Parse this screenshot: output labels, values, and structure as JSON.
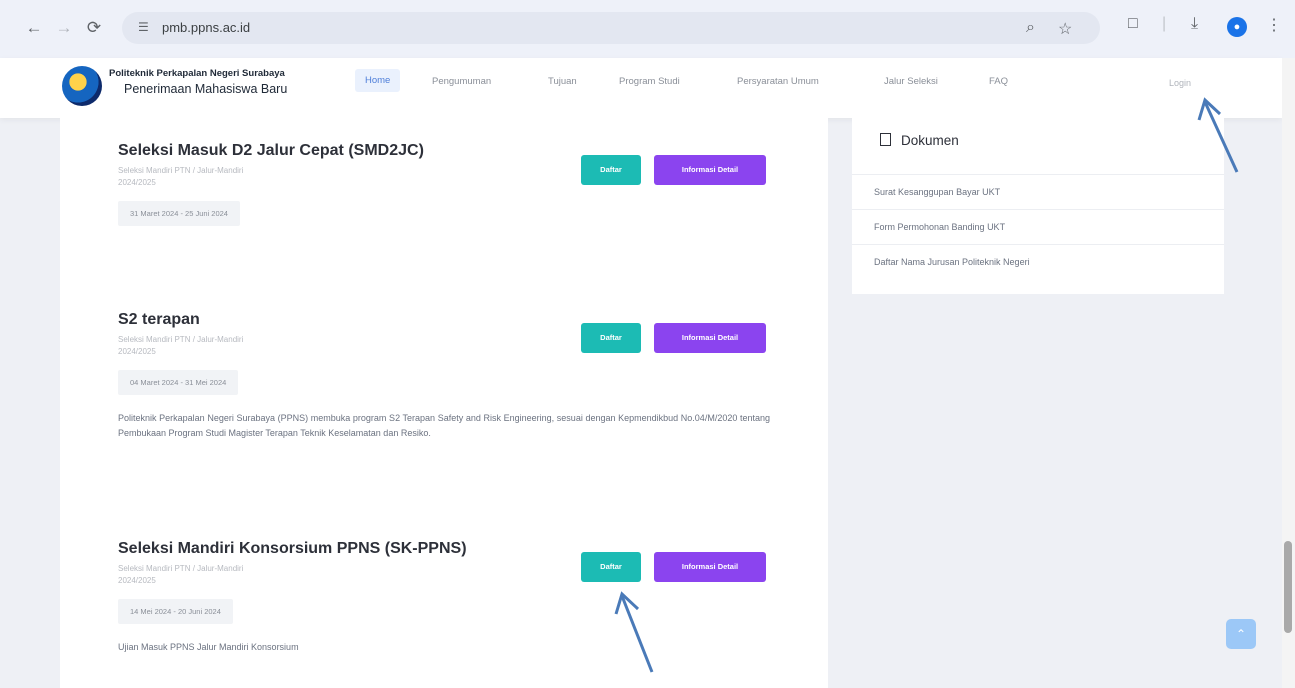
{
  "browser": {
    "url": "pmb.ppns.ac.id"
  },
  "header": {
    "brand_line1": "Politeknik Perkapalan Negeri Surabaya",
    "brand_line2": "Penerimaan Mahasiswa Baru",
    "nav": [
      "Home",
      "Pengumuman",
      "Tujuan",
      "Program Studi",
      "Persyaratan Umum",
      "Jalur Seleksi",
      "FAQ"
    ],
    "login": "Login"
  },
  "programs": [
    {
      "title": "Seleksi Masuk D2 Jalur Cepat (SMD2JC)",
      "category": "Seleksi Mandiri PTN / Jalur-Mandiri",
      "year": "2024/2025",
      "period": "31 Maret 2024 - 25 Juni 2024",
      "description": ""
    },
    {
      "title": "S2 terapan",
      "category": "Seleksi Mandiri PTN / Jalur-Mandiri",
      "year": "2024/2025",
      "period": "04 Maret 2024 - 31 Mei 2024",
      "description": "Politeknik Perkapalan Negeri Surabaya (PPNS) membuka program S2 Terapan Safety and Risk Engineering, sesuai dengan Kepmendikbud No.04/M/2020 tentang Pembukaan Program Studi Magister Terapan Teknik Keselamatan dan Resiko."
    },
    {
      "title": "Seleksi Mandiri Konsorsium PPNS (SK-PPNS)",
      "category": "Seleksi Mandiri PTN / Jalur-Mandiri",
      "year": "2024/2025",
      "period": "14 Mei 2024 - 20 Juni 2024",
      "description": "Ujian Masuk PPNS Jalur Mandiri Konsorsium"
    }
  ],
  "buttons": {
    "daftar": "Daftar",
    "detail": "Informasi Detail"
  },
  "sidebar": {
    "title": "Dokumen",
    "items": [
      "Surat Kesanggupan Bayar UKT",
      "Form Permohonan Banding UKT",
      "Daftar Nama Jurusan Politeknik Negeri"
    ]
  },
  "icons": {
    "back": "arrow-left-icon",
    "forward": "arrow-right-icon",
    "reload": "reload-icon",
    "site_info": "tune-icon",
    "zoom": "zoom-icon",
    "bookmark": "star-icon",
    "extensions": "puzzle-icon",
    "download": "download-icon",
    "profile": "person-icon",
    "menu": "kebab-menu-icon",
    "document": "document-icon",
    "to_top": "chevron-up-icon"
  },
  "colors": {
    "daftar": "#1cbbb4",
    "detail": "#8b44ef",
    "annotation_arrow": "#4a7ab8"
  }
}
